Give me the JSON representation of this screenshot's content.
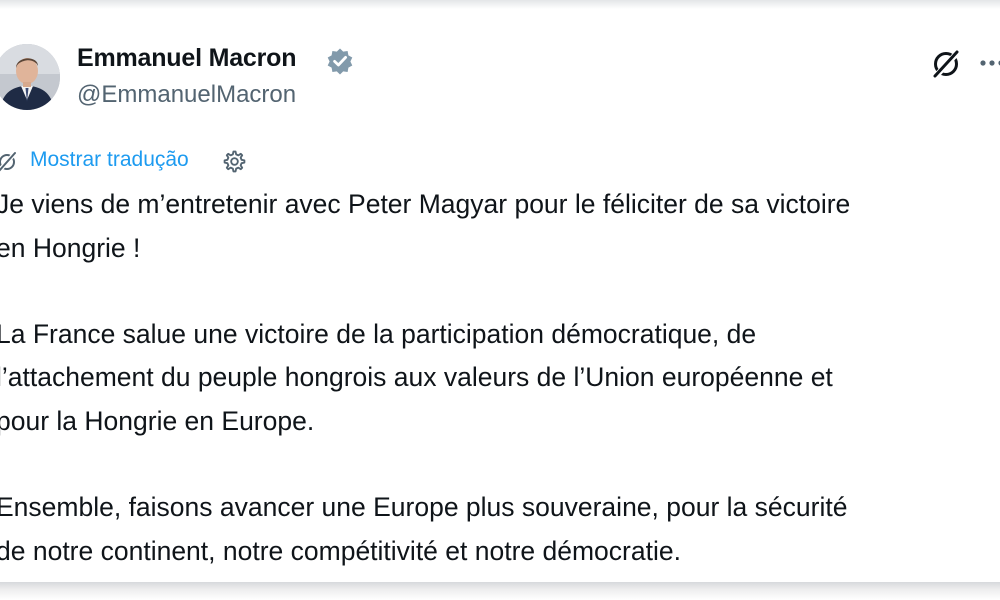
{
  "tweet": {
    "author_name": "Emmanuel Macron",
    "author_handle": "@EmmanuelMacron",
    "translate_label": "Mostrar tradução",
    "lines": [
      "Je viens de m’entretenir avec Peter Magyar pour le féliciter de sa victoire",
      "en Hongrie !",
      "La France salue une victoire de la participation démocratique, de",
      "l’attachement du peuple hongrois aux valeurs de l’Union européenne et",
      "pour la Hongrie en Europe.",
      "Ensemble, faisons avancer une Europe plus souveraine, pour la sécurité",
      "de notre continent, notre compétitivité et notre démocratie."
    ]
  },
  "icons": {
    "verified": "verified-badge-icon",
    "grok": "grok-icon",
    "more": "more-options-icon",
    "translate": "translate-icon",
    "settings": "gear-icon"
  },
  "colors": {
    "text": "#0f1419",
    "secondary": "#536471",
    "link": "#1d9bf0",
    "verified_badge": "#829aab"
  }
}
